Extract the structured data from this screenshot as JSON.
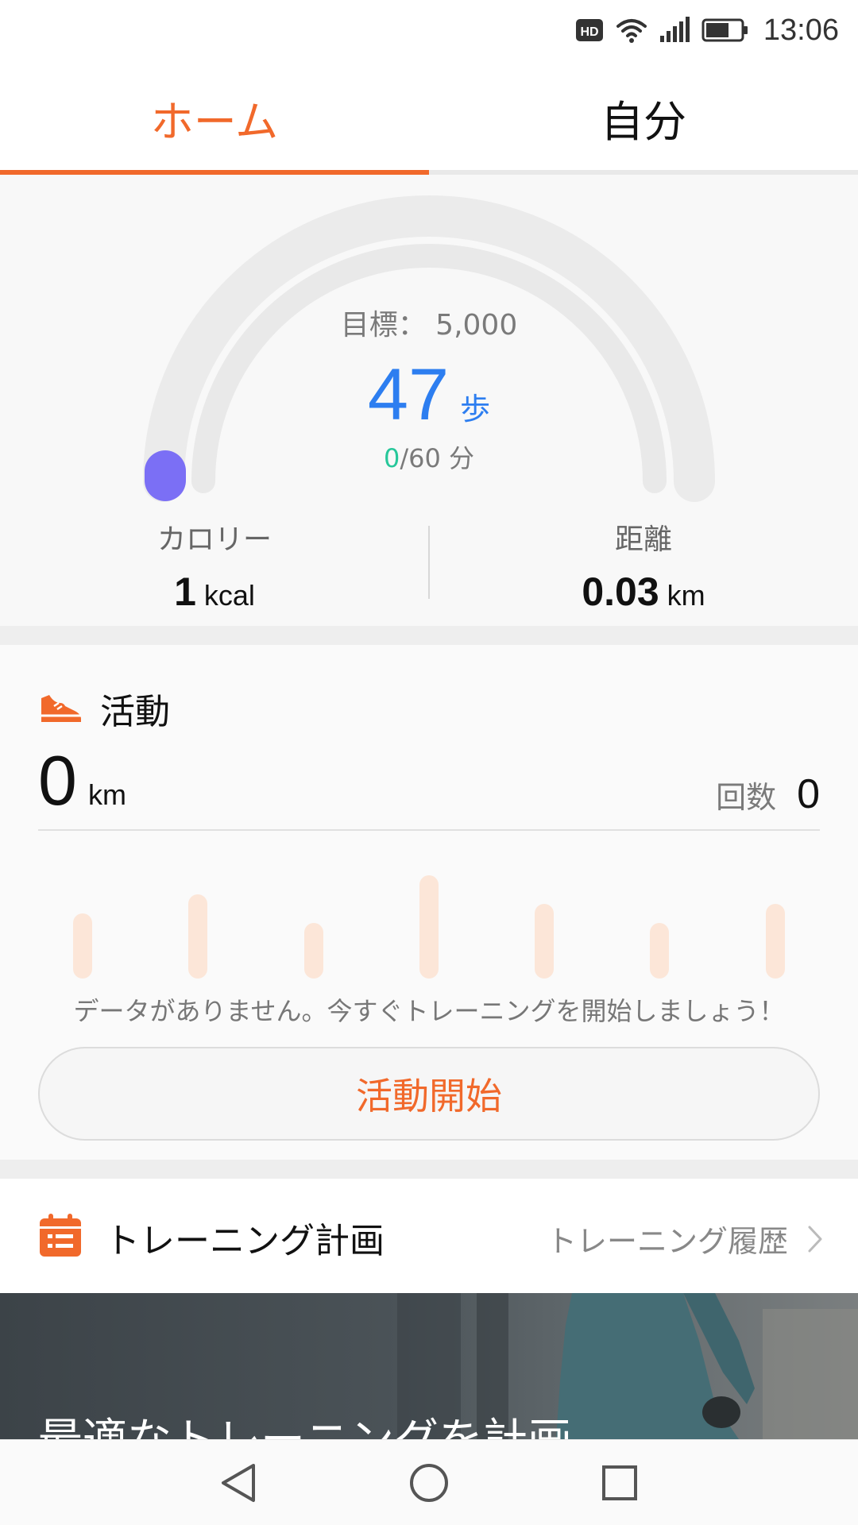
{
  "status_bar": {
    "time": "13:06",
    "icons": [
      "hd-icon",
      "wifi-icon",
      "signal-icon",
      "battery-icon"
    ]
  },
  "tabs": [
    {
      "label": "ホーム",
      "active": true
    },
    {
      "label": "自分",
      "active": false
    }
  ],
  "steps": {
    "goal_text": "目標： 5,000",
    "value": "47",
    "unit": "歩",
    "minutes_active": "0",
    "minutes_rest": "/60 分",
    "progress": 0.0094
  },
  "metrics": {
    "calories": {
      "label": "カロリー",
      "value": "1",
      "unit": "kcal"
    },
    "distance": {
      "label": "距離",
      "value": "0.03",
      "unit": "km"
    }
  },
  "activity": {
    "title": "活動",
    "distance_value": "0",
    "distance_unit": "km",
    "count_label": "回数",
    "count_value": "0",
    "no_data_text": "データがありません。今すぐトレーニングを開始しましょう！",
    "start_button": "活動開始"
  },
  "training_plan": {
    "title": "トレーニング計画",
    "history_label": "トレーニング履歴"
  },
  "banner": {
    "title": "最適なトレーニングを計画"
  },
  "colors": {
    "accent": "#f1692b",
    "steps_blue": "#2d7ef0",
    "active_green": "#27c79a",
    "gauge_dot": "#7b6ff5"
  },
  "nav_icons": [
    "back-icon",
    "home-icon",
    "recents-icon"
  ]
}
